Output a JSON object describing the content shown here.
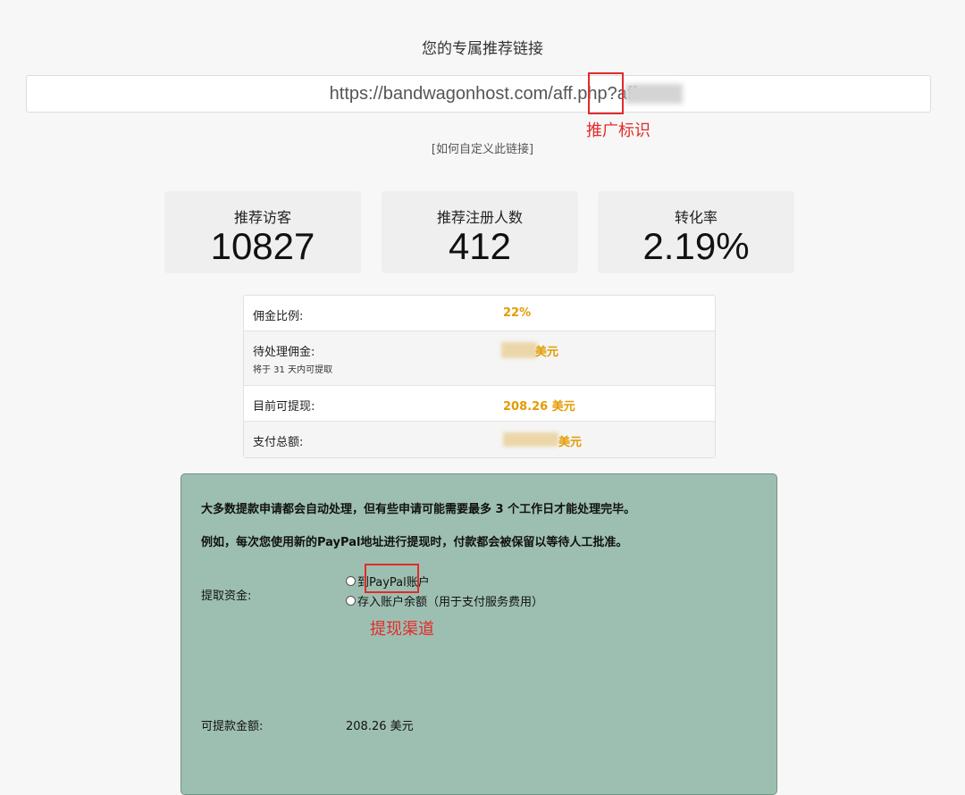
{
  "referral": {
    "heading": "您的专属推荐链接",
    "url": "https://bandwagonhost.com/aff.php?aff=",
    "customize_link": "[如何自定义此链接]"
  },
  "annotations": {
    "aff_label": "推广标识",
    "channel_label": "提现渠道"
  },
  "stats": [
    {
      "label": "推荐访客",
      "value": "10827"
    },
    {
      "label": "推荐注册人数",
      "value": "412"
    },
    {
      "label": "转化率",
      "value": "2.19%"
    }
  ],
  "commission": {
    "rate_label": "佣金比例:",
    "rate_value": "22%",
    "pending_label": "待处理佣金:",
    "pending_note": "将于 31 天内可提取",
    "pending_value": "美元",
    "available_label": "目前可提现:",
    "available_value": "208.26 美元",
    "total_label": "支付总额:",
    "total_value": "美元"
  },
  "withdraw": {
    "note1": "大多数提款申请都会自动处理，但有些申请可能需要最多 3 个工作日才能处理完毕。",
    "note2": "例如，每次您使用新的PayPal地址进行提现时，付款都会被保留以等待人工批准。",
    "funds_label": "提取资金:",
    "option_paypal": "到PayPal账户",
    "option_balance": "存入账户余额（用于支付服务费用）",
    "amount_label": "可提款金额:",
    "amount_value": "208.26 美元"
  },
  "colors": {
    "accent": "#e49b00",
    "annotation": "#e22b2b",
    "panel": "#9dbfb1"
  }
}
